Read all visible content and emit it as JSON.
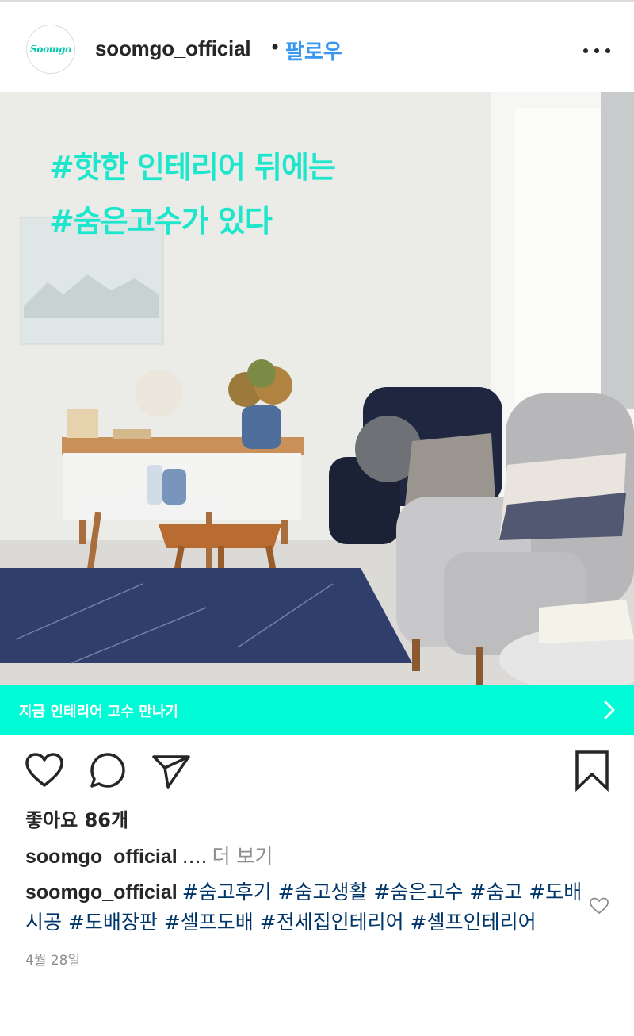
{
  "post": {
    "username": "soomgo_official",
    "separator": "•",
    "follow_label": "팔로우",
    "avatar_text": "Soomgo"
  },
  "image": {
    "overlay_line1": "#핫한 인테리어 뒤에는",
    "overlay_line2": "#숨은고수가 있다",
    "description": "living room interior"
  },
  "cta": {
    "label": "지금 인테리어 고수 만나기",
    "chevron_icon": "chevron-right-icon",
    "color": "#00fbd7"
  },
  "actions": {
    "like_icon": "heart-icon",
    "comment_icon": "comment-icon",
    "share_icon": "send-icon",
    "save_icon": "bookmark-icon"
  },
  "likes": "좋아요 86개",
  "caption": {
    "user": "soomgo_official",
    "ellipsis": "....",
    "more_label": "더 보기"
  },
  "comment": {
    "user": "soomgo_official",
    "tags": "#숨고후기 #숨고생활 #숨은고수 #숨고 #도배시공 #도배장판 #셀프도배 #전세집인테리어 #셀프인테리어"
  },
  "date": "4월 28일",
  "colors": {
    "accent": "#3897f0",
    "hashtag": "#003569",
    "overlay_text": "#1ee6cc"
  }
}
